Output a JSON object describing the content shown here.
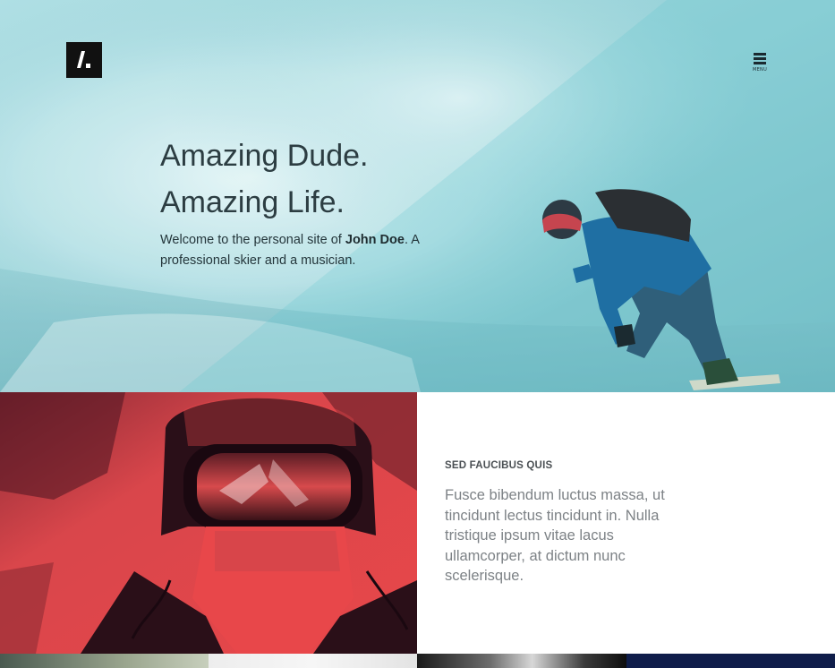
{
  "header": {
    "logo_text": "/.",
    "menu_label": "MENU"
  },
  "hero": {
    "title_line1": "Amazing Dude.",
    "title_line2": "Amazing Life.",
    "intro_before": "Welcome to the personal site of ",
    "intro_name": "John Doe",
    "intro_after": ". A professional skier and a musician."
  },
  "feature": {
    "kicker": "SED FAUCIBUS QUIS",
    "body": "Fusce bibendum luctus massa, ut tincidunt lectus tincidunt in. Nulla tristique ipsum vitae lacus ullamcorper, at dictum nunc scelerisque."
  },
  "colors": {
    "hero_tint": "#9fd6dc",
    "goggles_photo": "#e8474a",
    "strip_dark_blue": "#0f1d4a"
  }
}
